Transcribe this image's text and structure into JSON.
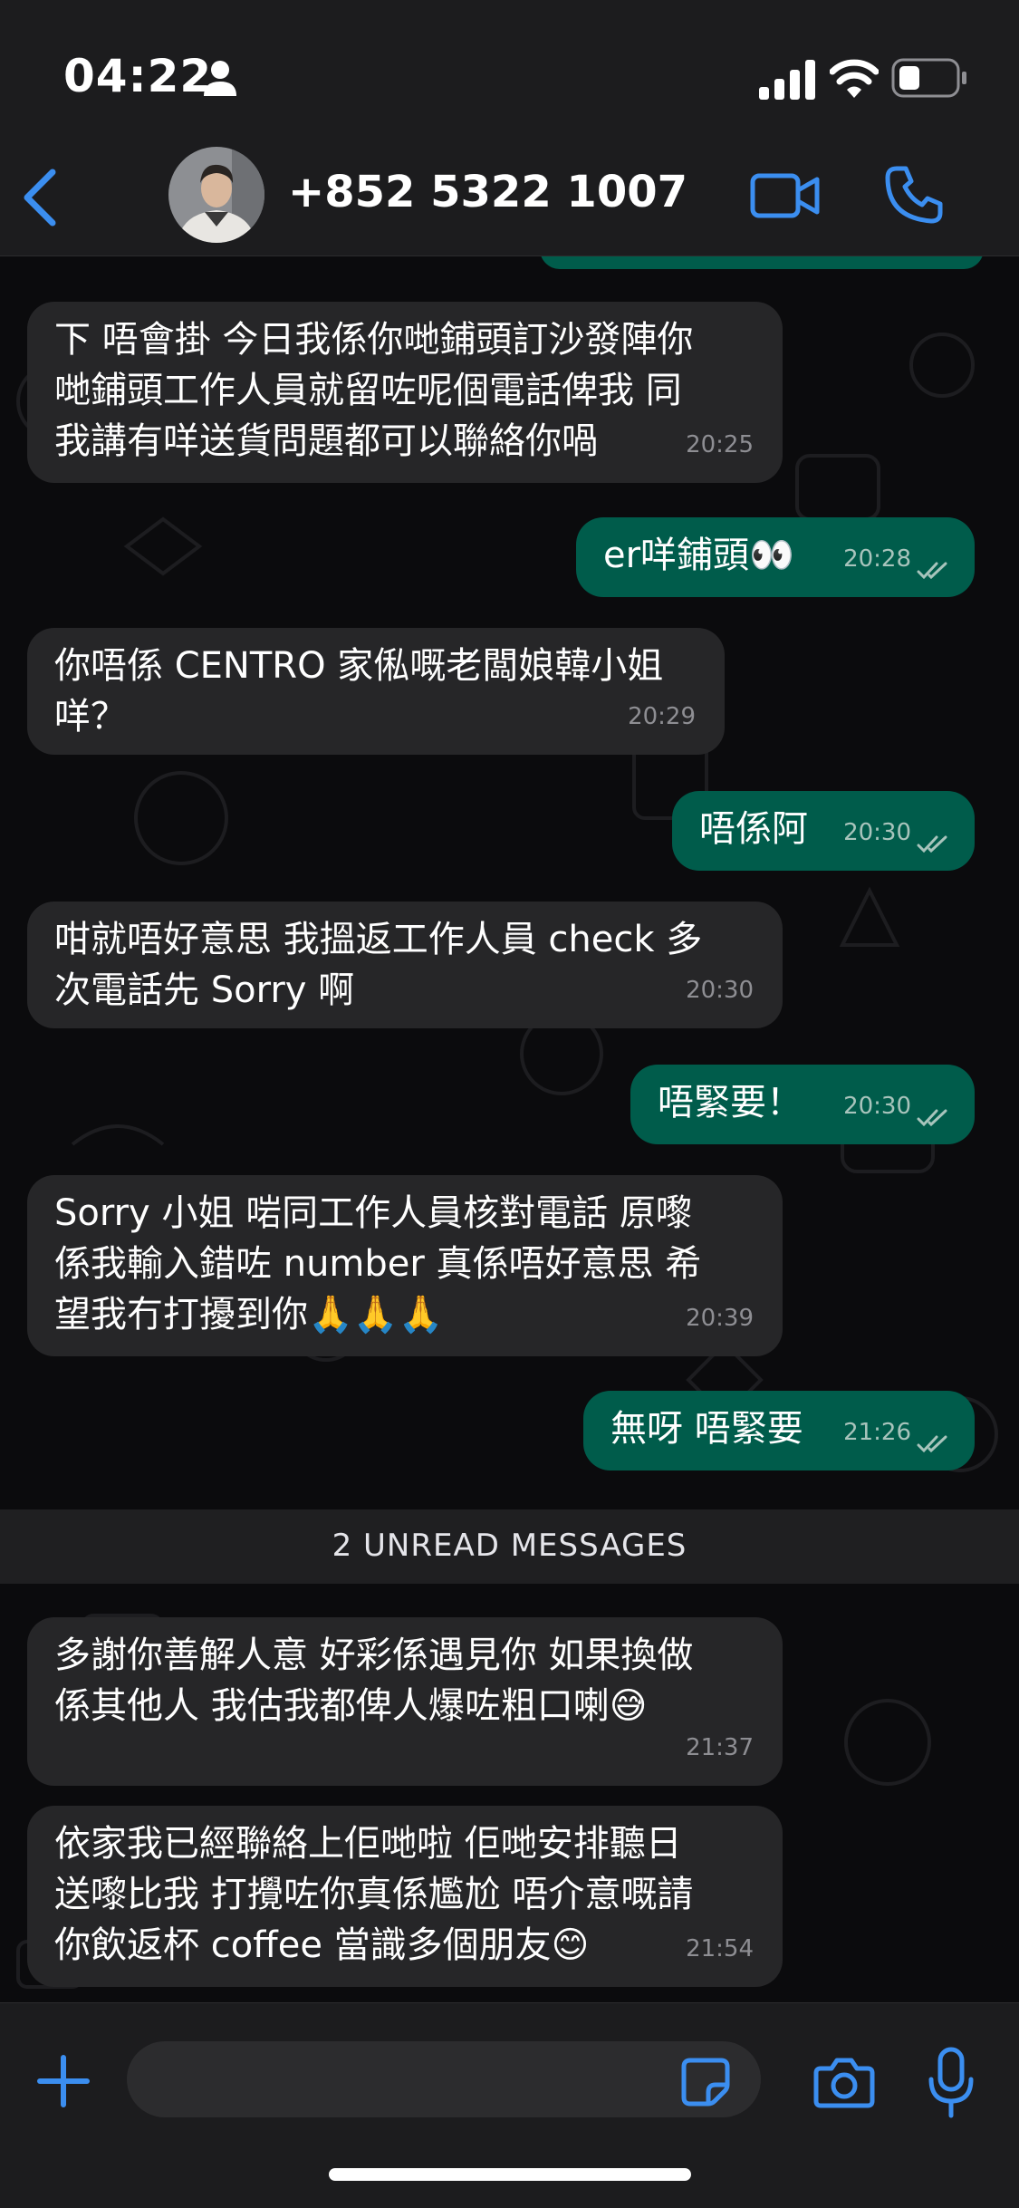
{
  "status_bar": {
    "time": "04:22"
  },
  "header": {
    "contact": "+852 5322 1007"
  },
  "messages": [
    {
      "dir": "in",
      "lines": "下 唔會掛 今日我係你哋鋪頭訂沙發陣你\n哋鋪頭工作人員就留咗呢個電話俾我 同\n我講有咩送貨問題都可以聯絡你喎",
      "time": "20:25"
    },
    {
      "dir": "out",
      "lines": "er咩鋪頭👀",
      "time": "20:28"
    },
    {
      "dir": "in",
      "lines": "你唔係 CENTRO 家俬嘅老闆娘韓小姐\n咩？",
      "time": "20:29"
    },
    {
      "dir": "out",
      "lines": "唔係阿",
      "time": "20:30"
    },
    {
      "dir": "in",
      "lines": "咁就唔好意思 我搵返工作人員 check 多\n次電話先 Sorry 啊",
      "time": "20:30"
    },
    {
      "dir": "out",
      "lines": "唔緊要！",
      "time": "20:30"
    },
    {
      "dir": "in",
      "lines": "Sorry 小姐 啱同工作人員核對電話 原嚟\n係我輸入錯咗 number 真係唔好意思 希\n望我冇打擾到你🙏🙏🙏",
      "time": "20:39"
    },
    {
      "dir": "out",
      "lines": "無呀 唔緊要",
      "time": "21:26"
    },
    {
      "dir": "in",
      "lines": "多謝你善解人意 好彩係遇見你 如果換做\n係其他人 我估我都俾人爆咗粗口喇😅",
      "time": "21:37"
    },
    {
      "dir": "in",
      "lines": "依家我已經聯絡上佢哋啦 佢哋安排聽日\n送嚟比我 打攪咗你真係尷尬 唔介意嘅請\n你飲返杯 coffee 當識多個朋友😊",
      "time": "21:54"
    }
  ],
  "unread_label": "2 UNREAD MESSAGES",
  "input": {
    "placeholder": ""
  },
  "colors": {
    "accent": "#3b8ef0",
    "outgoing": "#005c4b",
    "incoming": "#262628"
  },
  "icons": [
    "back-icon",
    "video-icon",
    "phone-icon",
    "plus-icon",
    "sticker-icon",
    "camera-icon",
    "mic-icon"
  ]
}
